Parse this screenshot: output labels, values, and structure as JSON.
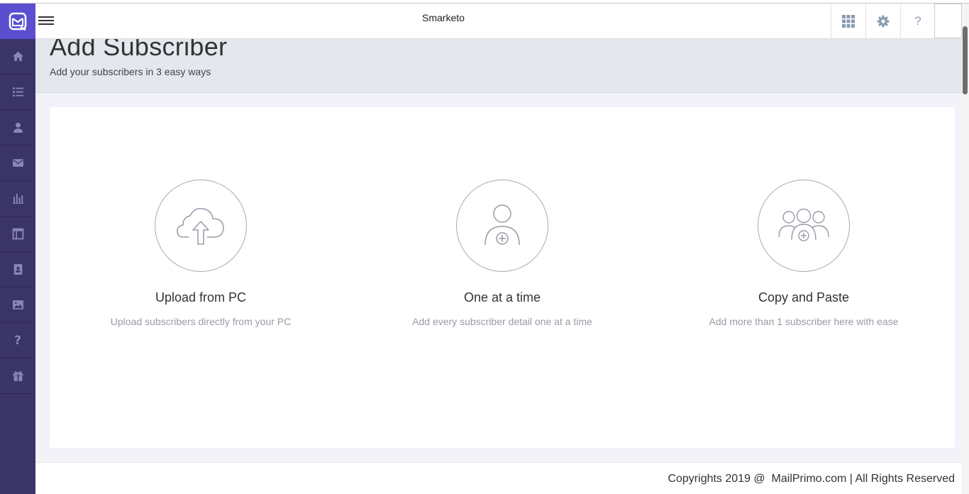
{
  "header": {
    "app_title": "Smarketo",
    "help_label": "?"
  },
  "sidebar": {
    "items": [
      {
        "name": "home-icon"
      },
      {
        "name": "list-icon"
      },
      {
        "name": "user-icon"
      },
      {
        "name": "mail-icon"
      },
      {
        "name": "bar-chart-icon"
      },
      {
        "name": "template-icon"
      },
      {
        "name": "contacts-book-icon"
      },
      {
        "name": "image-icon"
      },
      {
        "name": "help-icon"
      },
      {
        "name": "gift-icon"
      }
    ],
    "help_glyph": "?"
  },
  "page": {
    "title": "Add Subscriber",
    "subtitle": "Add your subscribers in 3 easy ways"
  },
  "options": [
    {
      "title": "Upload from PC",
      "description": "Upload subscribers directly from your PC",
      "icon": "cloud-upload-icon"
    },
    {
      "title": "One at a time",
      "description": "Add every subscriber detail one at a time",
      "icon": "add-single-user-icon"
    },
    {
      "title": "Copy and Paste",
      "description": "Add more than 1 subscriber here with ease",
      "icon": "add-group-icon"
    }
  ],
  "footer": {
    "text": "Copyrights 2019 @  MailPrimo.com | All Rights Reserved"
  },
  "colors": {
    "sidebar_bg": "#3b3466",
    "logo_bg": "#5b4fd0",
    "sidebar_icon": "#8b86b8",
    "header_icon": "#8a9bb0",
    "heading_band": "#e5e7ef"
  }
}
